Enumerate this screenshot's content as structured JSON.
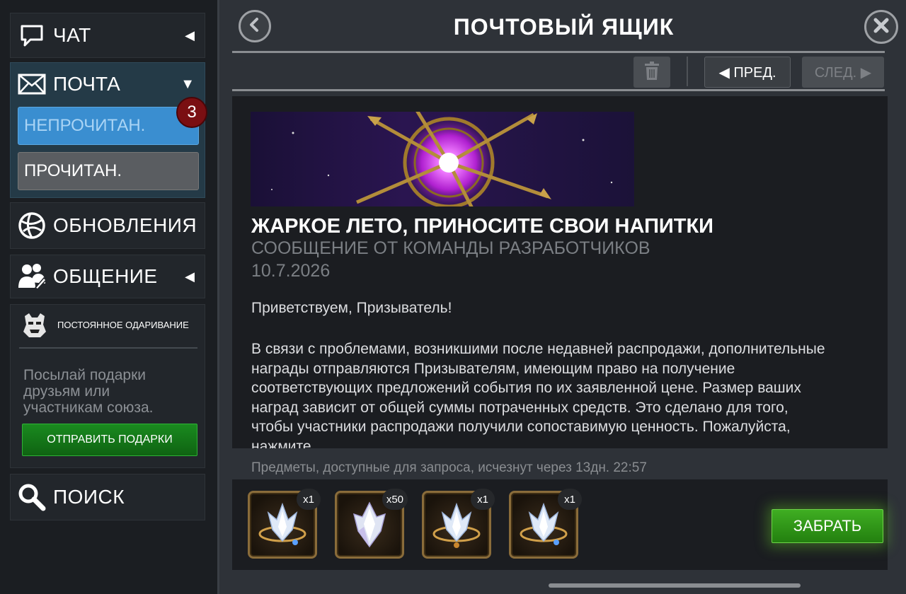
{
  "sidebar": {
    "chat_label": "ЧАТ",
    "mail_label": "ПОЧТА",
    "unread_label": "НЕПРОЧИТАН.",
    "unread_count": "3",
    "read_label": "ПРОЧИТАН.",
    "updates_label": "ОБНОВЛЕНИЯ",
    "social_label": "ОБЩЕНИЕ",
    "gift_title": "ПОСТОЯННОЕ ОДАРИВАНИЕ",
    "gift_desc": "Посылай подарки друзьям или участникам союза.",
    "send_gifts_label": "ОТПРАВИТЬ ПОДАРКИ",
    "search_label": "ПОИСК"
  },
  "header": {
    "title": "ПОЧТОВЫЙ ЯЩИК",
    "prev_label": "◀ ПРЕД.",
    "next_label": "СЛЕД. ▶"
  },
  "message": {
    "title": "ЖАРКОЕ ЛЕТО, ПРИНОСИТЕ СВОИ НАПИТКИ",
    "sender": "СООБЩЕНИЕ ОТ КОМАНДЫ РАЗРАБОТЧИКОВ",
    "date": "10.7.2026",
    "greeting": "Приветствуем, Призыватель!",
    "body": "В связи с проблемами, возникшими после недавней распродажи, дополнительные награды отправляются Призывателям, имеющим право на получение соответствующих предложений события по их заявленной цене. Размер ваших наград зависит от общей суммы потраченных средств. Это сделано для того, чтобы участники распродажи получили сопоставимую ценность. Пожалуйста, нажмите"
  },
  "footer": {
    "expiry": "Предметы, доступные для запроса, исчезнут через 13дн. 22:57",
    "rewards": [
      {
        "qty": "x1",
        "icon": "crystal-ring-icon"
      },
      {
        "qty": "x50",
        "icon": "crystal-shard-icon"
      },
      {
        "qty": "x1",
        "icon": "crystal-ring-icon"
      },
      {
        "qty": "x1",
        "icon": "crystal-ring-icon"
      }
    ],
    "claim_label": "ЗАБРАТЬ"
  },
  "colors": {
    "unread_tab": "#3a8ed0",
    "badge": "#7a0f12",
    "claim": "#3fae22",
    "send_gifts": "#1a8a1f"
  }
}
